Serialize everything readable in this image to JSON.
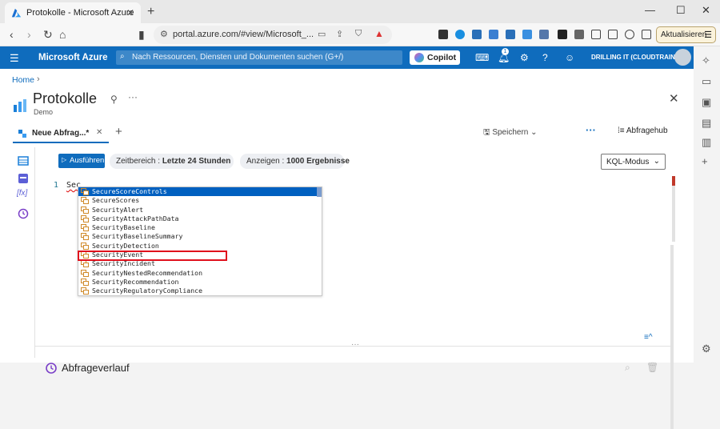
{
  "browser": {
    "tab_title": "Protokolle - Microsoft Azure",
    "url": "portal.azure.com/#view/Microsoft_...",
    "update_label": "Aktualisieren"
  },
  "azure": {
    "brand": "Microsoft Azure",
    "search_placeholder": "Nach Ressourcen, Diensten und Dokumenten suchen (G+/)",
    "copilot_label": "Copilot",
    "notifications_count": "1",
    "tenant": "DRILLING IT (CLOUDTRAIN.DE)",
    "accent_color": "#0f6cbd"
  },
  "page": {
    "breadcrumb": "Home",
    "title": "Protokolle",
    "subtitle": "Demo"
  },
  "query_tab": {
    "label": "Neue Abfrag...*",
    "save_label": "Speichern",
    "hub_label": "Abfragehub"
  },
  "toolbar": {
    "run_label": "Ausführen",
    "time_range_label": "Zeitbereich :",
    "time_range_value": "Letzte 24 Stunden",
    "show_label": "Anzeigen :",
    "show_value": "1000 Ergebnisse",
    "mode_label": "KQL-Modus"
  },
  "editor": {
    "line_number": "1",
    "code": "Sec"
  },
  "suggestions": [
    "SecureScoreControls",
    "SecureScores",
    "SecurityAlert",
    "SecurityAttackPathData",
    "SecurityBaseline",
    "SecurityBaselineSummary",
    "SecurityDetection",
    "SecurityEvent",
    "SecurityIncident",
    "SecurityNestedRecommendation",
    "SecurityRecommendation",
    "SecurityRegulatoryCompliance"
  ],
  "selected_suggestion": "SecureScoreControls",
  "highlighted_suggestion": "SecurityEvent",
  "history": {
    "title": "Abfrageverlauf"
  },
  "icons": {
    "tab_favicon": "azure-logo-icon",
    "page": "log-analytics-icon",
    "suggestion": "table-icon"
  }
}
